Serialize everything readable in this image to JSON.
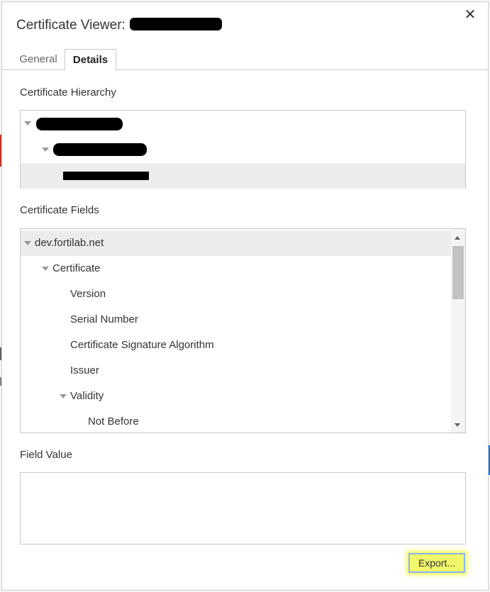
{
  "dialog": {
    "title": "Certificate Viewer:",
    "close_glyph": "✕"
  },
  "tabs": [
    {
      "label": "General",
      "selected": false
    },
    {
      "label": "Details",
      "selected": true
    }
  ],
  "hierarchy": {
    "label": "Certificate Hierarchy"
  },
  "fields": {
    "label": "Certificate Fields",
    "items": [
      {
        "text": "dev.fortilab.net",
        "expanded": true
      },
      {
        "text": "Certificate",
        "expanded": true
      },
      {
        "text": "Version"
      },
      {
        "text": "Serial Number"
      },
      {
        "text": "Certificate Signature Algorithm"
      },
      {
        "text": "Issuer"
      },
      {
        "text": "Validity",
        "expanded": true
      },
      {
        "text": "Not Before"
      }
    ]
  },
  "field_value": {
    "label": "Field Value",
    "value": ""
  },
  "export_button": {
    "label": "Export..."
  },
  "colors": {
    "export_highlight": "#f0f76a",
    "selected_row": "#ececec",
    "accent_blue": "#1a73e8"
  },
  "icons": [
    "close-icon",
    "expand-triangle-icon",
    "scroll-up-icon",
    "scroll-down-icon"
  ]
}
